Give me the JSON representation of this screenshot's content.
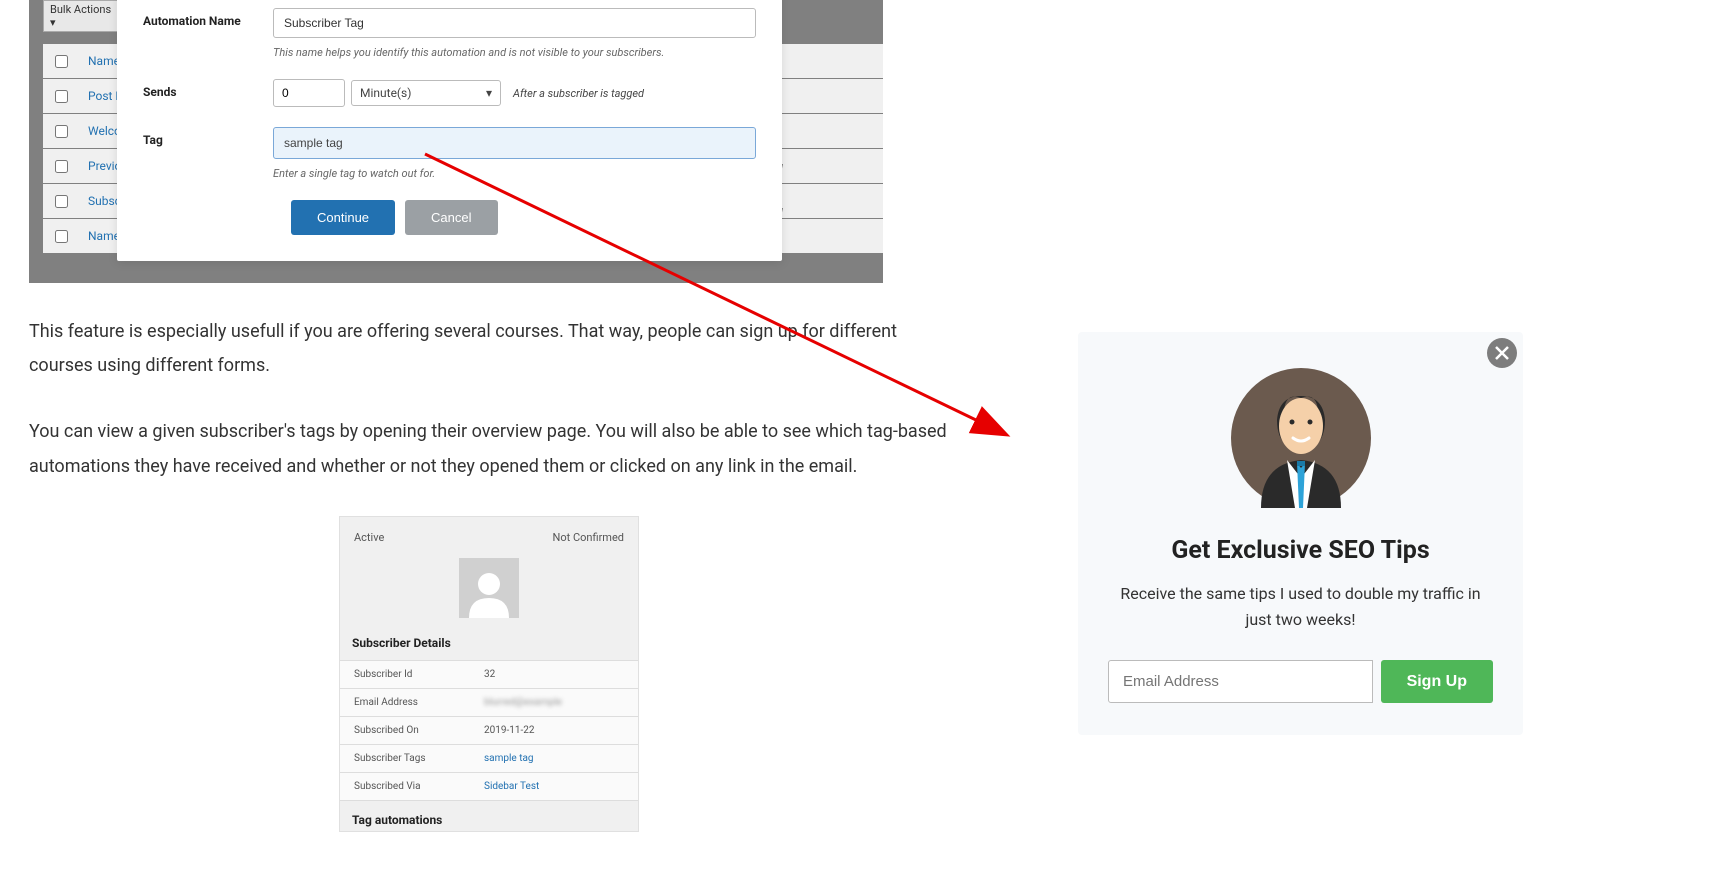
{
  "screenshot1": {
    "bulk_actions_label": "Bulk Actions",
    "rows": [
      "Name",
      "Post Not",
      "Welcome",
      "Previous",
      "Subscrib",
      "Name"
    ],
    "tag_col": [
      "ag",
      "ag"
    ],
    "form": {
      "automation_name_label": "Automation Name",
      "automation_name_value": "Subscriber Tag",
      "automation_name_help": "This name helps you identify this automation and is not visible to your subscribers.",
      "sends_label": "Sends",
      "sends_value": "0",
      "sends_unit": "Minute(s)",
      "sends_after": "After a subscriber is tagged",
      "tag_label": "Tag",
      "tag_value": "sample tag",
      "tag_help": "Enter a single tag to watch out for.",
      "continue_btn": "Continue",
      "cancel_btn": "Cancel"
    }
  },
  "paragraphs": {
    "p1": "This feature is especially usefull if you are offering several courses. That way, people can sign up for different courses using different forms.",
    "p2": "You can view a given subscriber's tags by opening their overview page. You will also be able to see which tag-based automations they have received and whether or not they opened them or clicked on any link in the email."
  },
  "screenshot2": {
    "status_active": "Active",
    "status_not_confirmed": "Not Confirmed",
    "details_title": "Subscriber Details",
    "rows": [
      {
        "label": "Subscriber Id",
        "value": "32",
        "link": false
      },
      {
        "label": "Email Address",
        "value": "blurred@example",
        "link": false,
        "blur": true
      },
      {
        "label": "Subscribed On",
        "value": "2019-11-22",
        "link": false
      },
      {
        "label": "Subscriber Tags",
        "value": "sample tag",
        "link": true
      },
      {
        "label": "Subscribed Via",
        "value": "Sidebar Test",
        "link": true
      }
    ],
    "tag_auto_title": "Tag automations"
  },
  "popup": {
    "title": "Get Exclusive SEO Tips",
    "description": "Receive the same tips I used to double my traffic in just two weeks!",
    "email_placeholder": "Email Address",
    "signup_btn": "Sign Up"
  },
  "colors": {
    "primary": "#2271b1",
    "success": "#4fb758",
    "arrow": "#e60000"
  }
}
